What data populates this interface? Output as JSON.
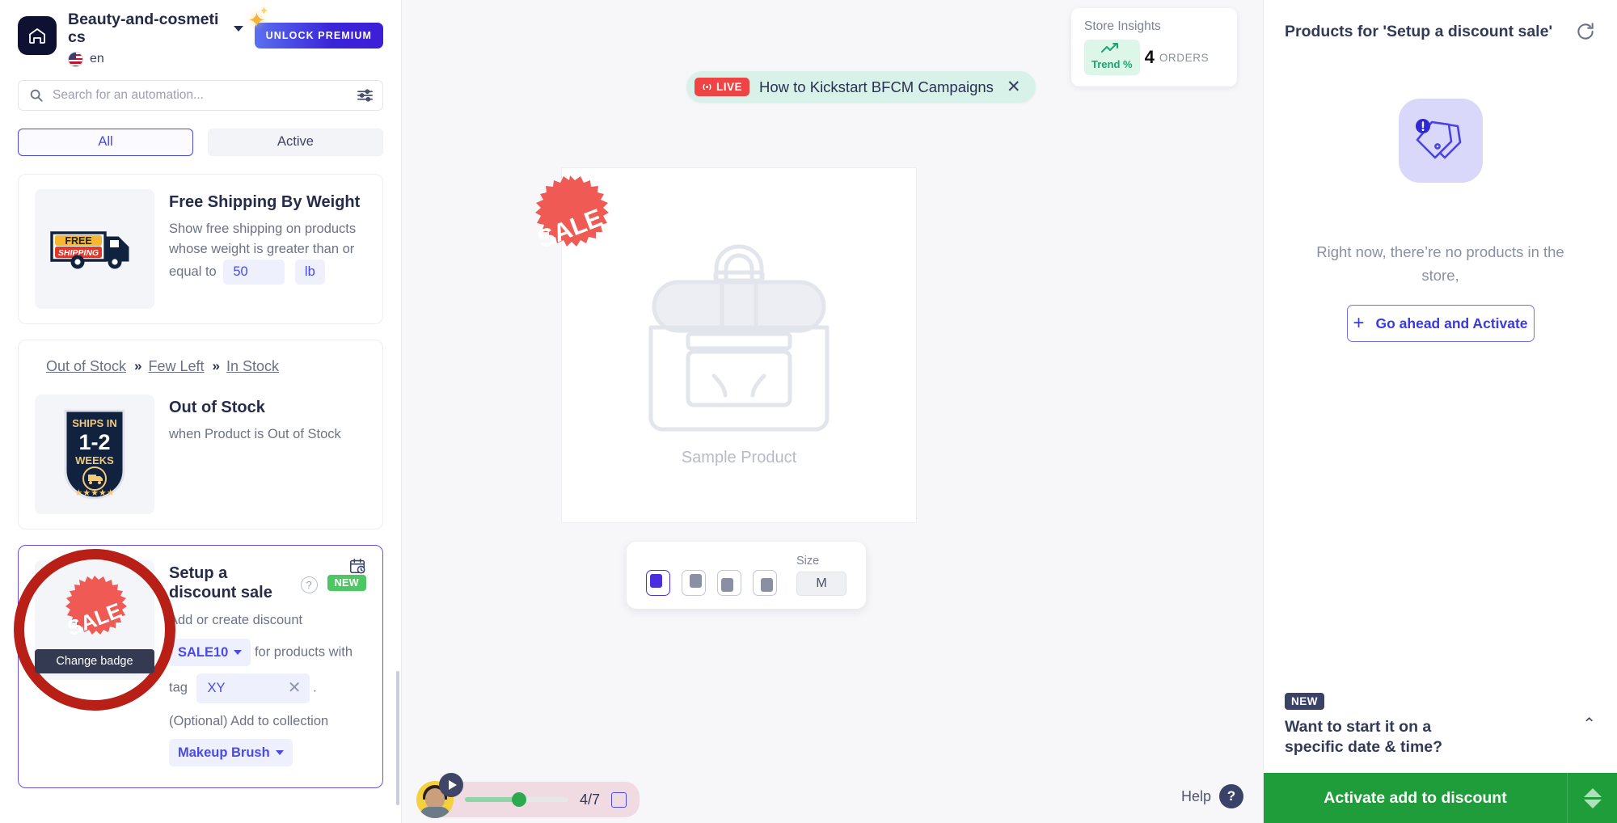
{
  "sidebar": {
    "home_icon": "home-icon",
    "store_name": "Beauty-and-cosmetics",
    "language": "en",
    "premium_label": "UNLOCK PREMIUM",
    "search_placeholder": "Search for an automation...",
    "tabs": [
      {
        "label": "All",
        "active": true
      },
      {
        "label": "Active",
        "active": false
      }
    ],
    "cards": [
      {
        "title": "Free Shipping By Weight",
        "desc_part1": "Show free shipping on products whose weight is greater than or equal to",
        "value": "50",
        "unit": "lb",
        "badge_text_top": "FREE",
        "badge_text_bottom": "SHIPPING"
      },
      {
        "breadcrumb": [
          "Out of Stock",
          "Few Left",
          "In Stock"
        ],
        "breadcrumb_sep": "»",
        "title": "Out of Stock",
        "desc": "when Product is Out of Stock",
        "badge_line1": "SHIPS IN",
        "badge_line2": "1-2",
        "badge_line3": "WEEKS"
      },
      {
        "title": "Setup a discount sale",
        "new_label": "NEW",
        "help_icon": "question-mark-icon",
        "calendar_icon": "calendar-clock-icon",
        "badge_text": "SALE",
        "tooltip": "Change badge",
        "line1": "Add or create discount",
        "discount_code": "SALE10",
        "line2_mid": "for products with",
        "tag_label": "tag",
        "tag_value": "XY",
        "line3": "(Optional) Add to collection",
        "collection": "Makeup Brush",
        "period": "."
      }
    ]
  },
  "canvas": {
    "live_banner": {
      "pill": "LIVE",
      "text": "How to Kickstart BFCM Campaigns",
      "close_icon": "close-icon"
    },
    "insights": {
      "title": "Store Insights",
      "trend_label": "Trend %",
      "trend_icon": "trending-up-icon",
      "orders_count": "4",
      "orders_label": "ORDERS"
    },
    "preview": {
      "badge_text": "SALE",
      "product_label": "Sample Product",
      "product_icon": "backpack-outline-icon"
    },
    "toolbar": {
      "positions": [
        "top-left",
        "top-right",
        "bottom-left",
        "bottom-right"
      ],
      "selected_position": "top-left",
      "size_label": "Size",
      "size_value": "M"
    },
    "player": {
      "play_icon": "play-icon",
      "step": "4/7",
      "expand_icon": "square-icon"
    },
    "help": {
      "label": "Help",
      "icon": "question-mark-icon"
    }
  },
  "right_panel": {
    "title": "Products for 'Setup a discount sale'",
    "refresh_icon": "refresh-icon",
    "empty_icon": "tags-alert-icon",
    "empty_text": "Right now, there’re no products in the store,",
    "activate_label": "Go ahead and Activate",
    "activate_icon": "plus-icon",
    "schedule": {
      "new_tag": "NEW",
      "text": "Want to start it on a specific date & time?",
      "chevron": "chevron-up-icon"
    },
    "cta": {
      "label": "Activate add to discount",
      "up_icon": "triangle-up-icon",
      "down_icon": "triangle-down-icon"
    }
  },
  "colors": {
    "accent": "#4a4ae8",
    "premium_gradient_start": "#5a70f0",
    "premium_gradient_end": "#3d1fd6",
    "green_cta": "#1f9d3b",
    "new_badge_green": "#4cc764",
    "live_red": "#ef4444",
    "annotation_red": "#b81f16",
    "sale_badge": "#ef5b54",
    "dark_navy": "#0f1133"
  }
}
